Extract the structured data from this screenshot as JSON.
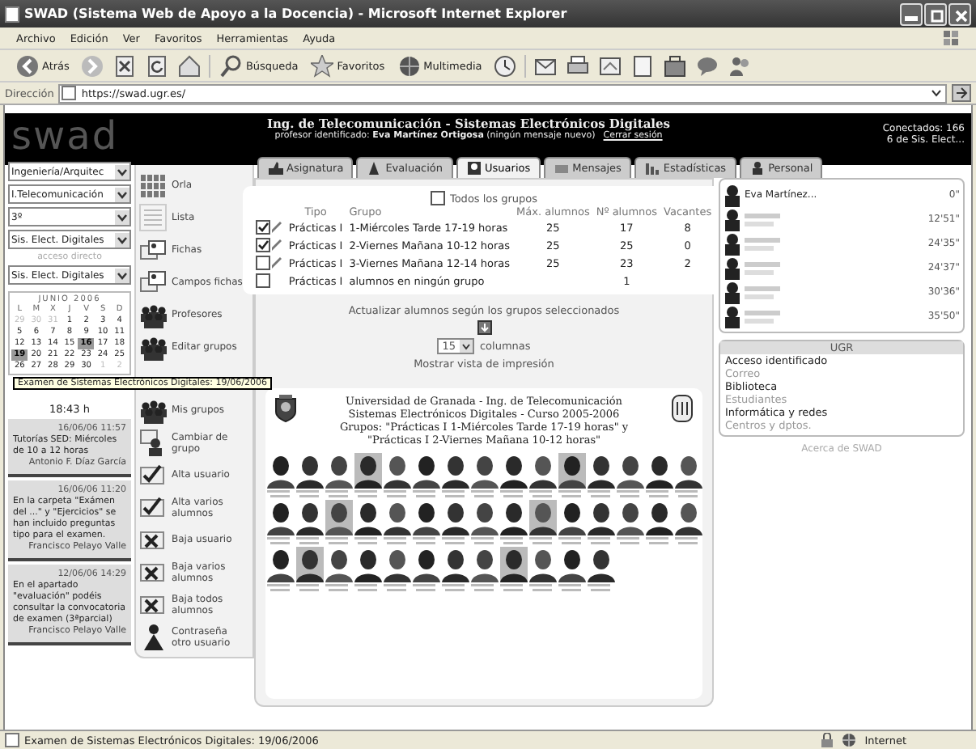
{
  "window": {
    "title": "SWAD (Sistema Web de Apoyo a la Docencia) - Microsoft Internet Explorer"
  },
  "menu": [
    "Archivo",
    "Edición",
    "Ver",
    "Favoritos",
    "Herramientas",
    "Ayuda"
  ],
  "toolbar": [
    {
      "kind": "back",
      "label": "Atrás"
    },
    {
      "kind": "forward"
    },
    {
      "kind": "stop"
    },
    {
      "kind": "refresh"
    },
    {
      "kind": "home"
    },
    {
      "kind": "search",
      "label": "Búsqueda"
    },
    {
      "kind": "star",
      "label": "Favoritos"
    },
    {
      "kind": "media",
      "label": "Multimedia"
    },
    {
      "kind": "history"
    },
    {
      "kind": "mail"
    },
    {
      "kind": "print"
    },
    {
      "kind": "edit"
    },
    {
      "kind": "page"
    },
    {
      "kind": "tool"
    },
    {
      "kind": "chat"
    },
    {
      "kind": "people"
    }
  ],
  "address": {
    "label": "Dirección",
    "value": "https://swad.ugr.es/"
  },
  "header": {
    "logo": "swad",
    "title": "Ing. de Telecomunicación - Sistemas Electrónicos Digitales",
    "user_prefix": "profesor identificado:",
    "user": "Eva Martínez Ortigosa",
    "messages": "(ningún mensaje nuevo)",
    "logout": "Cerrar sesión",
    "connected": "Conectados: 166",
    "connected_course": "6 de Sis. Elect..."
  },
  "selectors": [
    {
      "value": "Ingeniería/Arquitec"
    },
    {
      "value": "I.Telecomunicación"
    },
    {
      "value": "3º"
    },
    {
      "value": "Sis. Elect. Digitales"
    }
  ],
  "shortcut": {
    "label": "acceso directo",
    "value": "Sis. Elect. Digitales"
  },
  "calendar": {
    "month": "JUNIO 2006",
    "weekdays": [
      "L",
      "M",
      "X",
      "J",
      "V",
      "S",
      "D"
    ],
    "weeks": [
      [
        {
          "d": "29",
          "other": true,
          "selected": false
        },
        {
          "d": "30",
          "other": true,
          "selected": false
        },
        {
          "d": "31",
          "other": true,
          "selected": false
        },
        {
          "d": "1",
          "other": false,
          "selected": false
        },
        {
          "d": "2",
          "other": false,
          "selected": false
        },
        {
          "d": "3",
          "other": false,
          "selected": false
        },
        {
          "d": "4",
          "other": false,
          "selected": false
        }
      ],
      [
        {
          "d": "5",
          "other": false,
          "selected": false
        },
        {
          "d": "6",
          "other": false,
          "selected": false
        },
        {
          "d": "7",
          "other": false,
          "selected": false
        },
        {
          "d": "8",
          "other": false,
          "selected": false
        },
        {
          "d": "9",
          "other": false,
          "selected": false
        },
        {
          "d": "10",
          "other": false,
          "selected": false
        },
        {
          "d": "11",
          "other": false,
          "selected": false
        }
      ],
      [
        {
          "d": "12",
          "other": false,
          "selected": false
        },
        {
          "d": "13",
          "other": false,
          "selected": false
        },
        {
          "d": "14",
          "other": false,
          "selected": false
        },
        {
          "d": "15",
          "other": false,
          "selected": false
        },
        {
          "d": "16",
          "other": false,
          "selected": true
        },
        {
          "d": "17",
          "other": false,
          "selected": false
        },
        {
          "d": "18",
          "other": false,
          "selected": false
        }
      ],
      [
        {
          "d": "19",
          "other": false,
          "selected": true
        },
        {
          "d": "20",
          "other": false,
          "selected": false
        },
        {
          "d": "21",
          "other": false,
          "selected": false
        },
        {
          "d": "22",
          "other": false,
          "selected": false
        },
        {
          "d": "23",
          "other": false,
          "selected": false
        },
        {
          "d": "24",
          "other": false,
          "selected": false
        },
        {
          "d": "25",
          "other": false,
          "selected": false
        }
      ],
      [
        {
          "d": "26",
          "other": false,
          "selected": false
        },
        {
          "d": "27",
          "other": false,
          "selected": false
        },
        {
          "d": "28",
          "other": false,
          "selected": false
        },
        {
          "d": "29",
          "other": false,
          "selected": false
        },
        {
          "d": "30",
          "other": false,
          "selected": false
        },
        {
          "d": "1",
          "other": true,
          "selected": false
        },
        {
          "d": "2",
          "other": true,
          "selected": false
        }
      ]
    ],
    "tooltip": "Examen de Sistemas Electrónicos Digitales: 19/06/2006"
  },
  "clock": "18:43 h",
  "notices": [
    {
      "date": "16/06/06 11:57",
      "text": "Tutorías SED: Miércoles de 10 a 12 horas",
      "author": "Antonio F. Díaz García"
    },
    {
      "date": "16/06/06 11:20",
      "text": "En la carpeta \"Exámen del ...\" y \"Ejercicios\" se han incluido preguntas tipo para el examen.",
      "author": "Francisco Pelayo Valle"
    },
    {
      "date": "12/06/06 14:29",
      "text": "En el apartado \"evaluación\" podéis consultar la convocatoria de examen (3ªparcial)",
      "author": "Francisco Pelayo Valle"
    }
  ],
  "options": [
    {
      "kind": "grid",
      "label": "Orla"
    },
    {
      "kind": "list",
      "label": "Lista"
    },
    {
      "kind": "cards",
      "label": "Fichas"
    },
    {
      "kind": "fields",
      "label": "Campos fichas"
    },
    {
      "kind": "group",
      "label": "Profesores"
    },
    {
      "kind": "group",
      "label": "Editar grupos"
    },
    {
      "kind": "group",
      "label": "Mis grupos"
    },
    {
      "kind": "swap",
      "label": "Cambiar de grupo"
    },
    {
      "kind": "add",
      "label": "Alta usuario"
    },
    {
      "kind": "add",
      "label": "Alta varios alumnos"
    },
    {
      "kind": "remove",
      "label": "Baja usuario"
    },
    {
      "kind": "remove",
      "label": "Baja varios alumnos"
    },
    {
      "kind": "remove",
      "label": "Baja todos alumnos"
    },
    {
      "kind": "key",
      "label": "Contraseña otro usuario"
    }
  ],
  "tabs": [
    {
      "label": "Asignatura",
      "selected": false
    },
    {
      "label": "Evaluación",
      "selected": false
    },
    {
      "label": "Usuarios",
      "selected": true
    },
    {
      "label": "Mensajes",
      "selected": false
    },
    {
      "label": "Estadísticas",
      "selected": false
    },
    {
      "label": "Personal",
      "selected": false
    }
  ],
  "groups": {
    "all": {
      "label": "Todos los grupos",
      "checked": false
    },
    "columns": [
      "Tipo",
      "Grupo",
      "Máx. alumnos",
      "Nº alumnos",
      "Vacantes"
    ],
    "rows": [
      {
        "checked": true,
        "editable": true,
        "type": "Prácticas I",
        "group": "1-Miércoles Tarde 17-19 horas",
        "max": "25",
        "count": "17",
        "free": "8"
      },
      {
        "checked": true,
        "editable": true,
        "type": "Prácticas I",
        "group": "2-Viernes Mañana 10-12 horas",
        "max": "25",
        "count": "25",
        "free": "0"
      },
      {
        "checked": false,
        "editable": true,
        "type": "Prácticas I",
        "group": "3-Viernes Mañana 12-14 horas",
        "max": "25",
        "count": "23",
        "free": "2"
      },
      {
        "checked": false,
        "editable": false,
        "type": "Prácticas I",
        "group": "alumnos en ningún grupo",
        "count": "1"
      }
    ]
  },
  "update_label": "Actualizar alumnos según los grupos seleccionados",
  "columns_select": {
    "value": "15",
    "label": "columnas"
  },
  "print_link": "Mostrar vista de impresión",
  "class_photo": {
    "lines": [
      "Universidad de Granada - Ing. de Telecomunicación",
      "Sistemas Electrónicos Digitales - Curso 2005-2006",
      "Grupos: \"Prácticas I 1-Miércoles Tarde 17-19 horas\" y",
      "\"Prácticas I 2-Viernes Mañana 10-12 horas\""
    ]
  },
  "connected_users": [
    {
      "name": "Eva Martínez...",
      "time": "0\""
    },
    {
      "time": "12'51\""
    },
    {
      "time": "24'35\""
    },
    {
      "time": "24'37\""
    },
    {
      "time": "30'36\""
    },
    {
      "time": "35'50\""
    }
  ],
  "links": {
    "title": "UGR",
    "items": [
      "Acceso identificado",
      "Correo",
      "Biblioteca",
      "Estudiantes",
      "Informática y redes",
      "Centros y dptos."
    ]
  },
  "about": "Acerca de SWAD",
  "status_bar": {
    "text": "Examen de Sistemas Electrónicos Digitales: 19/06/2006",
    "zone": "Internet"
  }
}
